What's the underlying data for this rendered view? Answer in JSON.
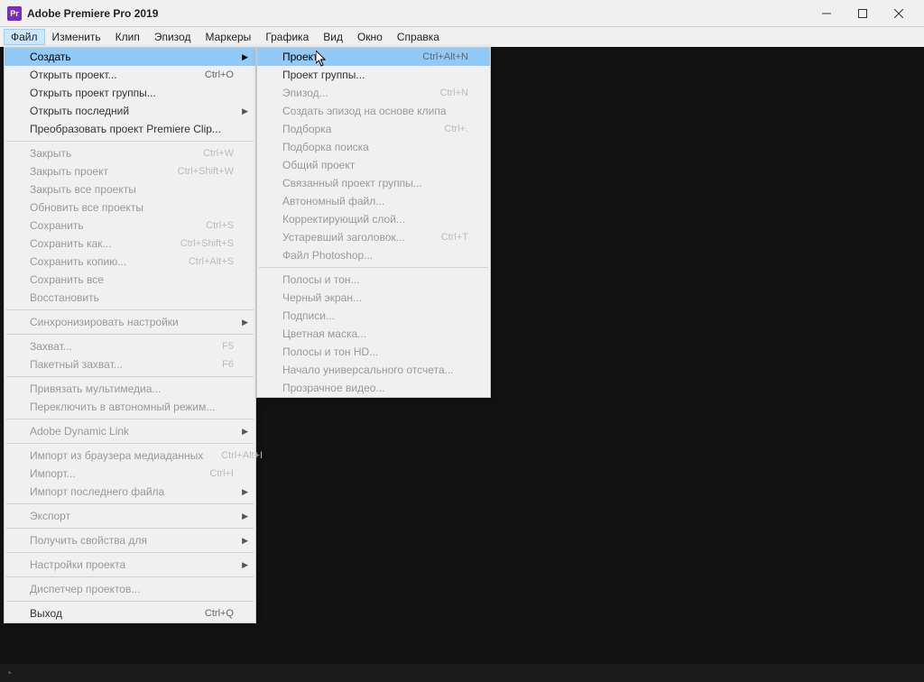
{
  "titlebar": {
    "title": "Adobe Premiere Pro 2019",
    "icon_label": "Pr"
  },
  "menubar": {
    "items": [
      {
        "label": "Файл",
        "active": true
      },
      {
        "label": "Изменить"
      },
      {
        "label": "Клип"
      },
      {
        "label": "Эпизод"
      },
      {
        "label": "Маркеры"
      },
      {
        "label": "Графика"
      },
      {
        "label": "Вид"
      },
      {
        "label": "Окно"
      },
      {
        "label": "Справка"
      }
    ]
  },
  "file_menu": {
    "items": [
      {
        "label": "Создать",
        "submenu": true,
        "highlighted": true
      },
      {
        "label": "Открыть проект...",
        "shortcut": "Ctrl+O"
      },
      {
        "label": "Открыть проект группы..."
      },
      {
        "label": "Открыть последний",
        "submenu": true
      },
      {
        "label": "Преобразовать проект Premiere Clip..."
      },
      {
        "sep": true
      },
      {
        "label": "Закрыть",
        "shortcut": "Ctrl+W",
        "disabled": true
      },
      {
        "label": "Закрыть проект",
        "shortcut": "Ctrl+Shift+W",
        "disabled": true
      },
      {
        "label": "Закрыть все проекты",
        "disabled": true
      },
      {
        "label": "Обновить все проекты",
        "disabled": true
      },
      {
        "label": "Сохранить",
        "shortcut": "Ctrl+S",
        "disabled": true
      },
      {
        "label": "Сохранить как...",
        "shortcut": "Ctrl+Shift+S",
        "disabled": true
      },
      {
        "label": "Сохранить копию...",
        "shortcut": "Ctrl+Alt+S",
        "disabled": true
      },
      {
        "label": "Сохранить все",
        "disabled": true
      },
      {
        "label": "Восстановить",
        "disabled": true
      },
      {
        "sep": true
      },
      {
        "label": "Синхронизировать настройки",
        "submenu": true,
        "disabled": true
      },
      {
        "sep": true
      },
      {
        "label": "Захват...",
        "shortcut": "F5",
        "disabled": true
      },
      {
        "label": "Пакетный захват...",
        "shortcut": "F6",
        "disabled": true
      },
      {
        "sep": true
      },
      {
        "label": "Привязать мультимедиа...",
        "disabled": true
      },
      {
        "label": "Переключить в автономный режим...",
        "disabled": true
      },
      {
        "sep": true
      },
      {
        "label": "Adobe Dynamic Link",
        "submenu": true,
        "disabled": true
      },
      {
        "sep": true
      },
      {
        "label": "Импорт из браузера медиаданных",
        "shortcut": "Ctrl+Alt+I",
        "disabled": true
      },
      {
        "label": "Импорт...",
        "shortcut": "Ctrl+I",
        "disabled": true
      },
      {
        "label": "Импорт последнего файла",
        "submenu": true,
        "disabled": true
      },
      {
        "sep": true
      },
      {
        "label": "Экспорт",
        "submenu": true,
        "disabled": true
      },
      {
        "sep": true
      },
      {
        "label": "Получить свойства для",
        "submenu": true,
        "disabled": true
      },
      {
        "sep": true
      },
      {
        "label": "Настройки проекта",
        "submenu": true,
        "disabled": true
      },
      {
        "sep": true
      },
      {
        "label": "Диспетчер проектов...",
        "disabled": true
      },
      {
        "sep": true
      },
      {
        "label": "Выход",
        "shortcut": "Ctrl+Q"
      }
    ]
  },
  "create_submenu": {
    "items": [
      {
        "label": "Проект...",
        "shortcut": "Ctrl+Alt+N",
        "highlighted": true
      },
      {
        "label": "Проект группы..."
      },
      {
        "label": "Эпизод...",
        "shortcut": "Ctrl+N",
        "disabled": true
      },
      {
        "label": "Создать эпизод на основе клипа",
        "disabled": true
      },
      {
        "label": "Подборка",
        "shortcut": "Ctrl+.",
        "disabled": true
      },
      {
        "label": "Подборка поиска",
        "disabled": true
      },
      {
        "label": "Общий проект",
        "disabled": true
      },
      {
        "label": "Связанный проект группы...",
        "disabled": true
      },
      {
        "label": "Автономный файл...",
        "disabled": true
      },
      {
        "label": "Корректирующий слой...",
        "disabled": true
      },
      {
        "label": "Устаревший заголовок...",
        "shortcut": "Ctrl+T",
        "disabled": true
      },
      {
        "label": "Файл Photoshop...",
        "disabled": true
      },
      {
        "sep": true
      },
      {
        "label": "Полосы и тон...",
        "disabled": true
      },
      {
        "label": "Черный экран...",
        "disabled": true
      },
      {
        "label": "Подписи...",
        "disabled": true
      },
      {
        "label": "Цветная маска...",
        "disabled": true
      },
      {
        "label": "Полосы и тон HD...",
        "disabled": true
      },
      {
        "label": "Начало универсального отсчета...",
        "disabled": true
      },
      {
        "label": "Прозрачное видео...",
        "disabled": true
      }
    ]
  }
}
